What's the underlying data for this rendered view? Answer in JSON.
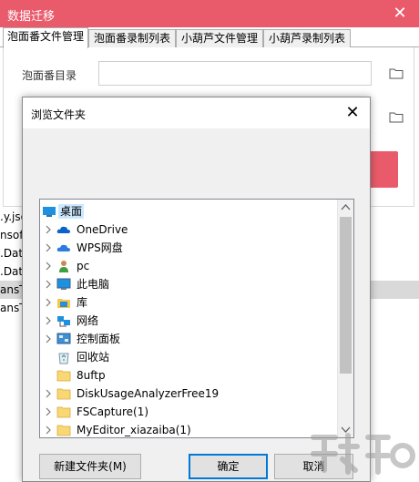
{
  "background_window": {
    "title": "数据迁移",
    "close_glyph": "✕",
    "tabs": [
      "泡面番文件管理",
      "泡面番录制列表",
      "小葫芦文件管理",
      "小葫芦录制列表"
    ],
    "active_tab": 0,
    "directory_label": "泡面番目录",
    "accent_color": "#e95a6a",
    "list_rows": [
      ".y.jso",
      "nsoft",
      ".Dat",
      ".Dat",
      "ansT",
      "ansT"
    ],
    "selected_row": 4
  },
  "dialog": {
    "title": "浏览文件夹",
    "close_glyph": "✕",
    "tree": [
      {
        "label": "桌面",
        "icon": "desktop-icon",
        "expandable": false,
        "level": 0,
        "selected": true
      },
      {
        "label": "OneDrive",
        "icon": "cloud-icon",
        "expandable": true,
        "level": 1
      },
      {
        "label": "WPS网盘",
        "icon": "cloud-icon",
        "expandable": true,
        "level": 1
      },
      {
        "label": "pc",
        "icon": "user-icon",
        "expandable": true,
        "level": 1
      },
      {
        "label": "此电脑",
        "icon": "computer-icon",
        "expandable": true,
        "level": 1
      },
      {
        "label": "库",
        "icon": "library-icon",
        "expandable": true,
        "level": 1
      },
      {
        "label": "网络",
        "icon": "network-icon",
        "expandable": true,
        "level": 1
      },
      {
        "label": "控制面板",
        "icon": "control-panel-icon",
        "expandable": true,
        "level": 1
      },
      {
        "label": "回收站",
        "icon": "recycle-bin-icon",
        "expandable": false,
        "level": 1
      },
      {
        "label": "8uftp",
        "icon": "folder-icon",
        "expandable": false,
        "level": 1
      },
      {
        "label": "DiskUsageAnalyzerFree19",
        "icon": "folder-icon",
        "expandable": true,
        "level": 1
      },
      {
        "label": "FSCapture(1)",
        "icon": "folder-icon",
        "expandable": true,
        "level": 1
      },
      {
        "label": "MyEditor_xiazaiba(1)",
        "icon": "folder-icon",
        "expandable": true,
        "level": 1
      }
    ],
    "buttons": {
      "new_folder": "新建文件夹(M)",
      "ok": "确定",
      "cancel": "取消"
    }
  }
}
